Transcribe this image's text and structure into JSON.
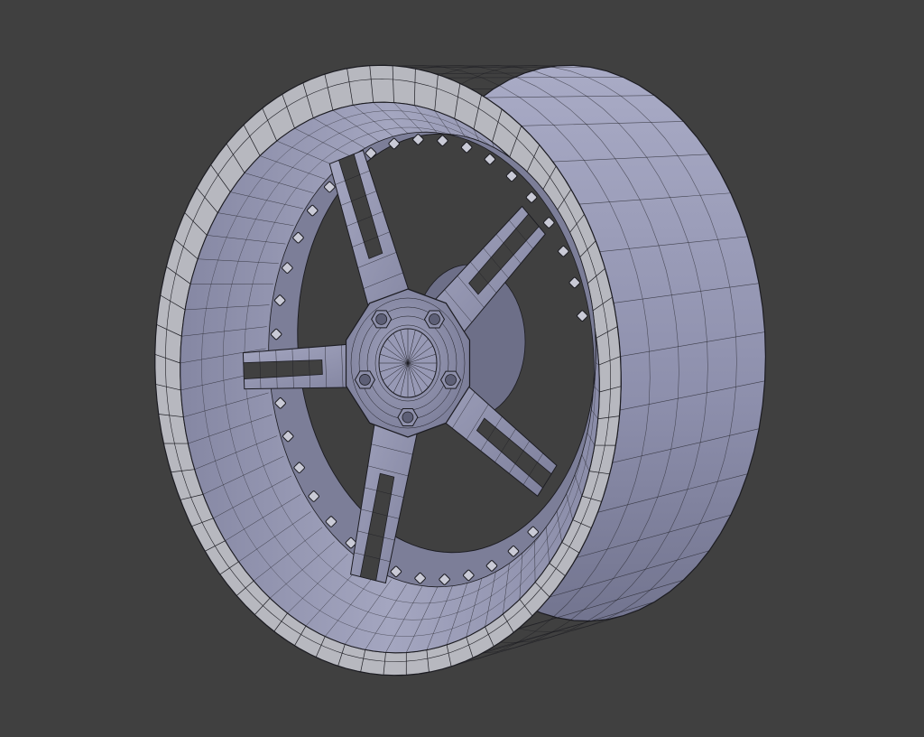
{
  "viewport": {
    "background": "#404040",
    "object": "wheel-rim-wireframe-mesh",
    "mesh_fill_light": "#a9abc6",
    "mesh_fill_mid": "#8c8eab",
    "mesh_fill_dark": "#5f6179",
    "wire_color": "#1c1c22",
    "rim_band_color": "#b7b8bf",
    "spoke_count": 5,
    "lug_nut_count": 5,
    "barrel_segments": 64,
    "bolt_ring_count": 40
  }
}
